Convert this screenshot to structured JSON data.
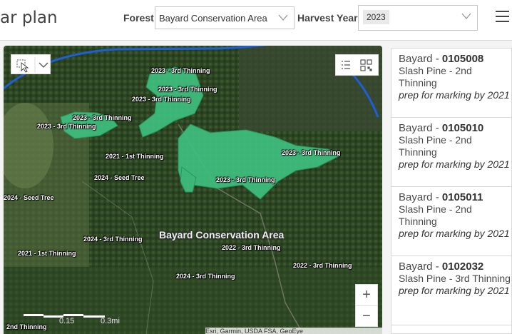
{
  "header": {
    "title": "ar plan",
    "forest_label": "Forest",
    "forest_value": "Bayard Conservation Area",
    "year_label": "Harvest Year",
    "year_value": "2023"
  },
  "map": {
    "area_label": "Bayard Conservation Area",
    "stand_labels": [
      "2023 - 3rd Thinning",
      "2023 - 3rd Thinning",
      "2023 - 3rd Thinning",
      "2023 - 3rd Thinning",
      "2023 - 3rd Thinning",
      "2023 - 3rd Thinning",
      "2023 - 3rd Thinning",
      "2021 - 1st Thinning",
      "2024 - Seed Tree",
      "2024 - Seed Tree",
      "2024 - 3rd Thinning",
      "2021 - 1st Thinning",
      "2022 - 3rd Thinning",
      "2022 - 3rd Thinning",
      "2024 - 3rd Thinning",
      "2nd Thinning"
    ],
    "scale_labels": [
      "0.15",
      "0.3mi"
    ],
    "zoom_in": "+",
    "zoom_out": "−",
    "attribution": "Esri, Garmin, USDA FSA, GeoEye",
    "icons": [
      "select-tool-icon",
      "chevron-down-icon",
      "list-icon",
      "qr-grid-icon"
    ],
    "colors": {
      "stand_fill": "#3fbf7f",
      "boundary": "#1f5fd6"
    }
  },
  "stands": [
    {
      "name": "Bayard",
      "id": "0105008",
      "type": "Slash Pine - 2nd Thinning",
      "status": "prep for marking by 2021"
    },
    {
      "name": "Bayard",
      "id": "0105010",
      "type": "Slash Pine - 2nd Thinning",
      "status": "prep for marking by 2021"
    },
    {
      "name": "Bayard",
      "id": "0105011",
      "type": "Slash Pine - 2nd Thinning",
      "status": "prep for marking by 2021"
    },
    {
      "name": "Bayard",
      "id": "0102032",
      "type": "Slash Pine - 3rd Thinning",
      "status": "prep for marking by 2021"
    }
  ]
}
